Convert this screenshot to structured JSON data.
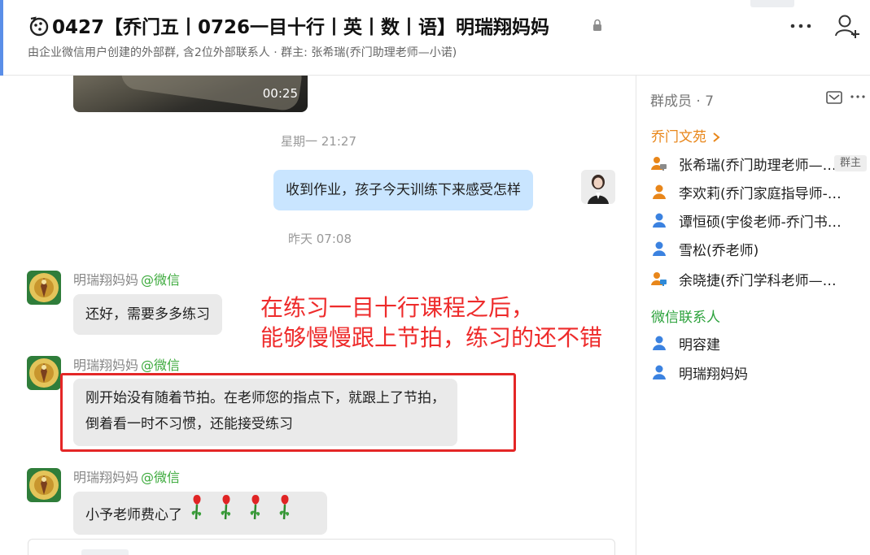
{
  "header": {
    "title": "0427【乔门五丨0726一目十行丨英丨数丨语】明瑞翔妈妈",
    "subtitle": "由企业微信用户创建的外部群, 含2位外部联系人 · 群主: 张希瑞(乔门助理老师—小诺)",
    "icons": [
      "group-chat-icon",
      "lock-icon",
      "more-icon",
      "add-member-icon"
    ]
  },
  "chat": {
    "video_duration": "00:25",
    "timestamp_1": "星期一 21:27",
    "msg_out": "收到作业，孩子今天训练下来感受怎样",
    "timestamp_2": "昨天 07:08",
    "messages": [
      {
        "sender": "明瑞翔妈妈",
        "source": "@微信",
        "lines": [
          "还好，需要多多练习"
        ]
      },
      {
        "sender": "明瑞翔妈妈",
        "source": "@微信",
        "lines": [
          "刚开始没有随着节拍。在老师您的指点下，就跟上了节拍，",
          "倒着看一时不习惯，还能接受练习"
        ]
      },
      {
        "sender": "明瑞翔妈妈",
        "source": "@微信",
        "lines": [
          "小予老师费心了"
        ]
      }
    ],
    "annotation": [
      "在练习一目十行课程之后，",
      "能够慢慢跟上节拍，练习的还不错"
    ],
    "annotation_color": "#ee2b2b"
  },
  "panel": {
    "title": "群成员 · 7",
    "org_section": "乔门文苑",
    "org_members": [
      {
        "name": "张希瑞(乔门助理老师—小诺)",
        "badge": "群主"
      },
      {
        "name": "李欢莉(乔门家庭指导师-暖暖)"
      },
      {
        "name": "谭恒硕(宇俊老师-乔门书院)"
      },
      {
        "name": "雪松(乔老师)"
      },
      {
        "name": "余晓捷(乔门学科老师——小予)"
      }
    ],
    "wx_section": "微信联系人",
    "wx_members": [
      {
        "name": "明容建"
      },
      {
        "name": "明瑞翔妈妈"
      }
    ]
  },
  "colors": {
    "accent_blue": "#5a8ee8",
    "bubble_out": "#c9e5ff",
    "bubble_in": "#eaeaea",
    "org_orange": "#e8861a",
    "wechat_green": "#2ca23c",
    "highlight_red": "#e42626"
  }
}
